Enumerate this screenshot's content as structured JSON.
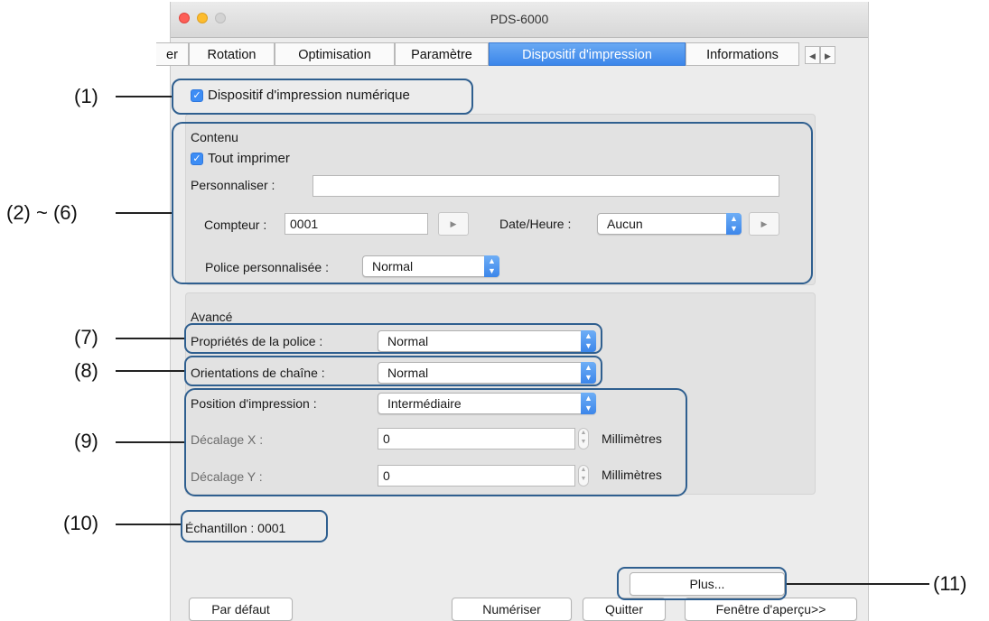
{
  "window": {
    "title": "PDS-6000"
  },
  "tabs": [
    {
      "label": "er"
    },
    {
      "label": "Rotation"
    },
    {
      "label": "Optimisation"
    },
    {
      "label": "Paramètre"
    },
    {
      "label": "Dispositif d'impression",
      "active": true
    },
    {
      "label": "Informations"
    }
  ],
  "tab_scroll": {
    "left": "◀",
    "right": "▶"
  },
  "imprinter": {
    "label": "Dispositif d'impression numérique",
    "checked": true
  },
  "contenu": {
    "title": "Contenu",
    "print_all_label": "Tout imprimer",
    "print_all_checked": true,
    "customize_label": "Personnaliser :",
    "customize_value": "",
    "counter_label": "Compteur :",
    "counter_value": "0001",
    "datetime_label": "Date/Heure :",
    "datetime_value": "Aucun",
    "custom_font_label": "Police personnalisée :",
    "custom_font_value": "Normal"
  },
  "avance": {
    "title": "Avancé",
    "font_props_label": "Propriétés de la police :",
    "font_props_value": "Normal",
    "string_orient_label": "Orientations de chaîne :",
    "string_orient_value": "Normal",
    "print_pos_label": "Position d'impression :",
    "print_pos_value": "Intermédiaire",
    "offset_x_label": "Décalage X :",
    "offset_x_value": "0",
    "offset_y_label": "Décalage Y :",
    "offset_y_value": "0",
    "unit": "Millimètres"
  },
  "sample": {
    "text": "Échantillon : 0001"
  },
  "buttons": {
    "more": "Plus...",
    "default": "Par défaut",
    "scan": "Numériser",
    "quit": "Quitter",
    "preview": "Fenêtre d'aperçu>>"
  },
  "callouts": {
    "c1": "(1)",
    "c2_6": "(2) ~ (6)",
    "c7": "(7)",
    "c8": "(8)",
    "c9": "(9)",
    "c10": "(10)",
    "c11": "(11)"
  },
  "colors": {
    "accent": "#3b86ea",
    "highlight_border": "#2f5f8f",
    "window_bg": "#ececec"
  }
}
